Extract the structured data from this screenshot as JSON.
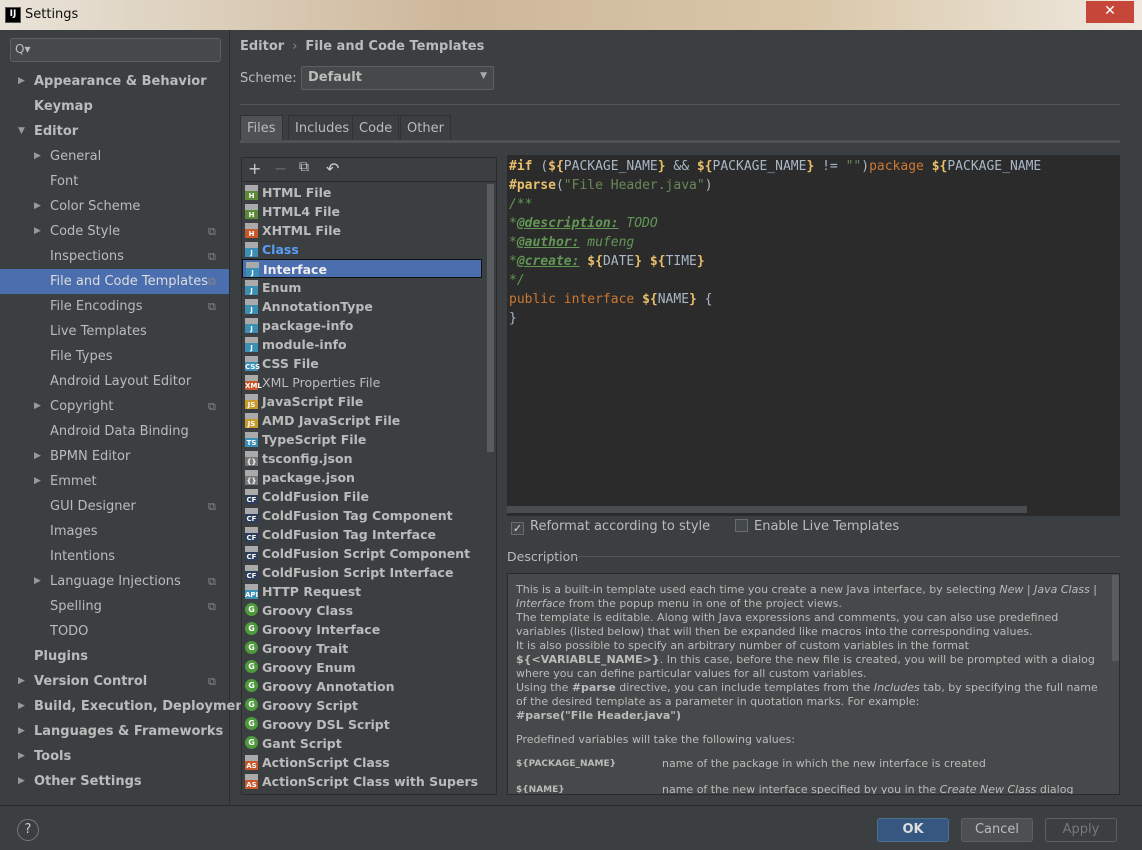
{
  "window": {
    "title": "Settings",
    "close": "✕"
  },
  "search": {
    "icon": "Q▾",
    "placeholder": ""
  },
  "sidebar": {
    "items": [
      {
        "label": "Appearance & Behavior",
        "level": 0,
        "arrow": "right",
        "bold": true
      },
      {
        "label": "Keymap",
        "level": 0,
        "bold": true
      },
      {
        "label": "Editor",
        "level": 0,
        "arrow": "down",
        "bold": true
      },
      {
        "label": "General",
        "level": 1,
        "arrow": "right"
      },
      {
        "label": "Font",
        "level": 1
      },
      {
        "label": "Color Scheme",
        "level": 1,
        "arrow": "right"
      },
      {
        "label": "Code Style",
        "level": 1,
        "arrow": "right",
        "project": true
      },
      {
        "label": "Inspections",
        "level": 1,
        "project": true
      },
      {
        "label": "File and Code Templates",
        "level": 1,
        "project": true,
        "selected": true
      },
      {
        "label": "File Encodings",
        "level": 1,
        "project": true
      },
      {
        "label": "Live Templates",
        "level": 1
      },
      {
        "label": "File Types",
        "level": 1
      },
      {
        "label": "Android Layout Editor",
        "level": 1
      },
      {
        "label": "Copyright",
        "level": 1,
        "arrow": "right",
        "project": true
      },
      {
        "label": "Android Data Binding",
        "level": 1
      },
      {
        "label": "BPMN Editor",
        "level": 1,
        "arrow": "right"
      },
      {
        "label": "Emmet",
        "level": 1,
        "arrow": "right"
      },
      {
        "label": "GUI Designer",
        "level": 1,
        "project": true
      },
      {
        "label": "Images",
        "level": 1
      },
      {
        "label": "Intentions",
        "level": 1
      },
      {
        "label": "Language Injections",
        "level": 1,
        "arrow": "right",
        "project": true
      },
      {
        "label": "Spelling",
        "level": 1,
        "project": true
      },
      {
        "label": "TODO",
        "level": 1
      },
      {
        "label": "Plugins",
        "level": 0,
        "bold": true
      },
      {
        "label": "Version Control",
        "level": 0,
        "arrow": "right",
        "bold": true,
        "project": true
      },
      {
        "label": "Build, Execution, Deployment",
        "level": 0,
        "arrow": "right",
        "bold": true
      },
      {
        "label": "Languages & Frameworks",
        "level": 0,
        "arrow": "right",
        "bold": true
      },
      {
        "label": "Tools",
        "level": 0,
        "arrow": "right",
        "bold": true
      },
      {
        "label": "Other Settings",
        "level": 0,
        "arrow": "right",
        "bold": true
      }
    ]
  },
  "breadcrumb": {
    "parent": "Editor",
    "sep": "›",
    "current": "File and Code Templates"
  },
  "scheme": {
    "label": "Scheme:",
    "value": "Default"
  },
  "tabs": [
    {
      "label": "Files",
      "active": true
    },
    {
      "label": "Includes"
    },
    {
      "label": "Code"
    },
    {
      "label": "Other"
    }
  ],
  "toolbar": {
    "add": "+",
    "remove": "−",
    "copy": "⧉",
    "reset": "↶"
  },
  "templates": [
    {
      "label": "HTML File",
      "icon": "H",
      "color": "#5d8a3a"
    },
    {
      "label": "HTML4 File",
      "icon": "H",
      "color": "#5d8a3a"
    },
    {
      "label": "XHTML File",
      "icon": "H",
      "color": "#c8582a"
    },
    {
      "label": "Class",
      "icon": "J",
      "color": "#3b8fb5",
      "modified": true
    },
    {
      "label": "Interface",
      "icon": "J",
      "color": "#3b8fb5",
      "selected": true
    },
    {
      "label": "Enum",
      "icon": "J",
      "color": "#3b8fb5"
    },
    {
      "label": "AnnotationType",
      "icon": "J",
      "color": "#3b8fb5"
    },
    {
      "label": "package-info",
      "icon": "J",
      "color": "#3b8fb5"
    },
    {
      "label": "module-info",
      "icon": "J",
      "color": "#3b8fb5"
    },
    {
      "label": "CSS File",
      "icon": "CSS",
      "color": "#3b8fb5"
    },
    {
      "label": "XML Properties File",
      "icon": "XML",
      "color": "#c8582a",
      "normal": true
    },
    {
      "label": "JavaScript File",
      "icon": "JS",
      "color": "#c89b2a"
    },
    {
      "label": "AMD JavaScript File",
      "icon": "JS",
      "color": "#c89b2a"
    },
    {
      "label": "TypeScript File",
      "icon": "TS",
      "color": "#3b8fb5"
    },
    {
      "label": "tsconfig.json",
      "icon": "{}",
      "color": "#777"
    },
    {
      "label": "package.json",
      "icon": "{}",
      "color": "#777"
    },
    {
      "label": "ColdFusion File",
      "icon": "CF",
      "color": "#2c3e5c"
    },
    {
      "label": "ColdFusion Tag Component",
      "icon": "CF",
      "color": "#2c3e5c"
    },
    {
      "label": "ColdFusion Tag Interface",
      "icon": "CF",
      "color": "#2c3e5c"
    },
    {
      "label": "ColdFusion Script Component",
      "icon": "CF",
      "color": "#2c3e5c"
    },
    {
      "label": "ColdFusion Script Interface",
      "icon": "CF",
      "color": "#2c3e5c"
    },
    {
      "label": "HTTP Request",
      "icon": "API",
      "color": "#3b8fb5"
    },
    {
      "label": "Groovy Class",
      "icon": "G",
      "color": "#4e9a3d",
      "round": true
    },
    {
      "label": "Groovy Interface",
      "icon": "G",
      "color": "#4e9a3d",
      "round": true
    },
    {
      "label": "Groovy Trait",
      "icon": "G",
      "color": "#4e9a3d",
      "round": true
    },
    {
      "label": "Groovy Enum",
      "icon": "G",
      "color": "#4e9a3d",
      "round": true
    },
    {
      "label": "Groovy Annotation",
      "icon": "G",
      "color": "#4e9a3d",
      "round": true
    },
    {
      "label": "Groovy Script",
      "icon": "G",
      "color": "#4e9a3d",
      "round": true
    },
    {
      "label": "Groovy DSL Script",
      "icon": "G",
      "color": "#4e9a3d",
      "round": true
    },
    {
      "label": "Gant Script",
      "icon": "G",
      "color": "#4e9a3d",
      "round": true
    },
    {
      "label": "ActionScript Class",
      "icon": "AS",
      "color": "#c8582a"
    },
    {
      "label": "ActionScript Class with Supers",
      "icon": "AS",
      "color": "#c8582a"
    }
  ],
  "code": {
    "l1": [
      "#if",
      "(",
      "${",
      "PACKAGE_NAME",
      "}",
      " && ",
      "${",
      "PACKAGE_NAME",
      "}",
      " != ",
      "\"\"",
      ")",
      "package ",
      "${",
      "PACKAGE_NAME"
    ],
    "l2": [
      "#parse",
      "(",
      "\"File Header.java\"",
      ")"
    ],
    "l3": "/**",
    "l4": [
      "*",
      "@description:",
      " TODO"
    ],
    "l5": [
      "*",
      "@author:",
      " mufeng"
    ],
    "l6": [
      "*",
      "@create:",
      " ",
      "${",
      "DATE",
      "}",
      " ",
      "${",
      "TIME",
      "}"
    ],
    "l7": "*/",
    "l8": [
      "public interface ",
      "${",
      "NAME",
      "}",
      " {"
    ],
    "l9": "}"
  },
  "options": {
    "reformat": {
      "label": "Reformat according to style",
      "checked": true
    },
    "live": {
      "label": "Enable Live Templates",
      "checked": false
    }
  },
  "description": {
    "label": "Description",
    "p1a": "This is a built-in template used each time you create a new Java interface, by selecting ",
    "p1b": "New | Java Class | Interface",
    "p1c": " from the popup menu in one of the project views.",
    "p2": "The template is editable. Along with Java expressions and comments, you can also use predefined variables (listed below) that will then be expanded like macros into the corresponding values.",
    "p3a": "It is also possible to specify an arbitrary number of custom variables in the format ",
    "p3b": "${<VARIABLE_NAME>}",
    "p3c": ". In this case, before the new file is created, you will be prompted with a dialog where you can define particular values for all custom variables.",
    "p4a": "Using the ",
    "p4b": "#parse",
    "p4c": " directive, you can include templates from the ",
    "p4d": "Includes",
    "p4e": " tab, by specifying the full name of the desired template as a parameter in quotation marks. For example:",
    "p5": "#parse(\"File Header.java\")",
    "p6": "Predefined variables will take the following values:",
    "vars": [
      {
        "name": "${PACKAGE_NAME}",
        "a": "name of the package in which the new interface is created",
        "b": "",
        "c": ""
      },
      {
        "name": "${NAME}",
        "a": "name of the new interface specified by you in the ",
        "b": "Create New Class",
        "c": " dialog"
      }
    ]
  },
  "footer": {
    "help": "?",
    "ok": "OK",
    "cancel": "Cancel",
    "apply": "Apply"
  }
}
